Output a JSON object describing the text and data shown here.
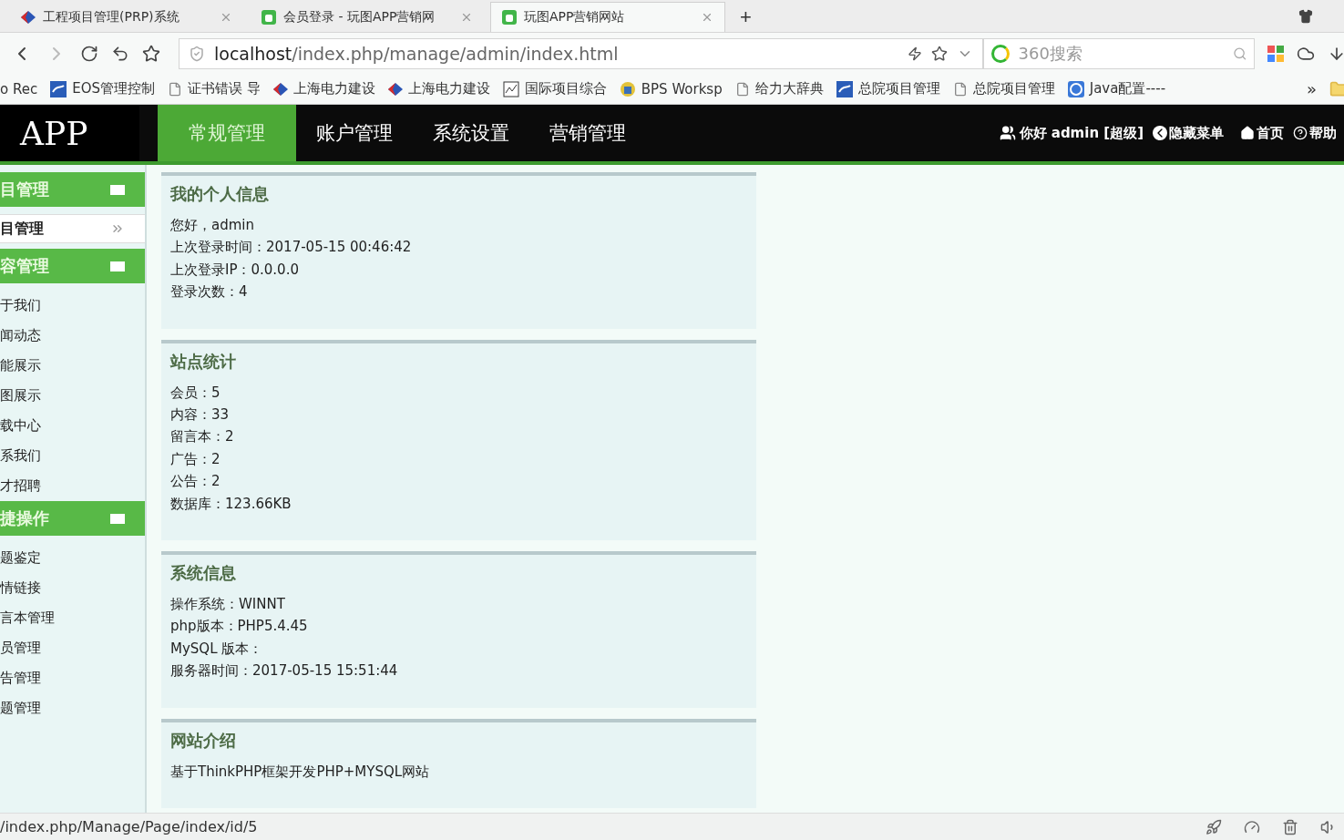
{
  "browser": {
    "tabs": [
      {
        "title": "工程项目管理(PRP)系统",
        "kind": "diamond",
        "selected": false
      },
      {
        "title": "会员登录 - 玩图APP营销网",
        "kind": "app",
        "selected": false
      },
      {
        "title": "玩图APP营销网站",
        "kind": "app",
        "selected": true
      }
    ],
    "new_tab": "+",
    "address": "**localhost**/index.php/manage/admin/index.html",
    "search": {
      "placeholder": "360搜索"
    },
    "bookmarks": [
      {
        "label": "o Rec",
        "kind": "none"
      },
      {
        "label": "EOS管理控制",
        "kind": "logo"
      },
      {
        "label": "证书错误 导",
        "kind": "page"
      },
      {
        "label": "上海电力建设",
        "kind": "diamond"
      },
      {
        "label": "上海电力建设",
        "kind": "diamond"
      },
      {
        "label": "国际项目综合",
        "kind": "chart"
      },
      {
        "label": "BPS Worksp",
        "kind": "badge"
      },
      {
        "label": "给力大辞典",
        "kind": "page"
      },
      {
        "label": "总院项目管理",
        "kind": "logo"
      },
      {
        "label": "总院项目管理",
        "kind": "page"
      },
      {
        "label": "Java配置----",
        "kind": "java"
      }
    ],
    "more": "»"
  },
  "app": {
    "logo": "APP",
    "nav": [
      {
        "label": "常规管理",
        "selected": true
      },
      {
        "label": "账户管理",
        "selected": false
      },
      {
        "label": "系统设置",
        "selected": false
      },
      {
        "label": "营销管理",
        "selected": false
      }
    ],
    "user": {
      "greeting": "你好 admin [超级]",
      "hide_menu": "隐藏菜单",
      "home": "首页",
      "help": "帮助"
    },
    "sidebar": [
      {
        "title": "目管理",
        "items": [
          {
            "label": "目管理",
            "kind": "arrow"
          }
        ]
      },
      {
        "title": "容管理",
        "items": [
          {
            "label": "于我们",
            "kind": "link"
          },
          {
            "label": "闻动态",
            "kind": "link"
          },
          {
            "label": "能展示",
            "kind": "link"
          },
          {
            "label": "图展示",
            "kind": "link"
          },
          {
            "label": "载中心",
            "kind": "link"
          },
          {
            "label": "系我们",
            "kind": "link"
          },
          {
            "label": "才招聘",
            "kind": "link"
          }
        ]
      },
      {
        "title": "捷操作",
        "items": [
          {
            "label": "题鉴定",
            "kind": "link"
          },
          {
            "label": "情链接",
            "kind": "link"
          },
          {
            "label": "言本管理",
            "kind": "link"
          },
          {
            "label": "员管理",
            "kind": "link"
          },
          {
            "label": "告管理",
            "kind": "link"
          },
          {
            "label": "题管理",
            "kind": "link"
          }
        ]
      }
    ],
    "panels": [
      {
        "title": "我的个人信息",
        "lines": [
          "您好，admin",
          "上次登录时间：2017-05-15 00:46:42",
          "上次登录IP：0.0.0.0",
          "登录次数：4"
        ]
      },
      {
        "title": "站点统计",
        "lines": [
          "会员：5",
          "内容：33",
          "留言本：2",
          "广告：2",
          "公告：2",
          "数据库：123.66KB"
        ]
      },
      {
        "title": "系统信息",
        "lines": [
          "操作系统：WINNT",
          "php版本：PHP5.4.45",
          "MySQL 版本：",
          "服务器时间：2017-05-15 15:51:44"
        ]
      },
      {
        "title": "网站介绍",
        "lines": [
          "基于ThinkPHP框架开发PHP+MYSQL网站"
        ]
      }
    ]
  },
  "status_bar": {
    "url": "/index.php/Manage/Page/index/id/5"
  }
}
